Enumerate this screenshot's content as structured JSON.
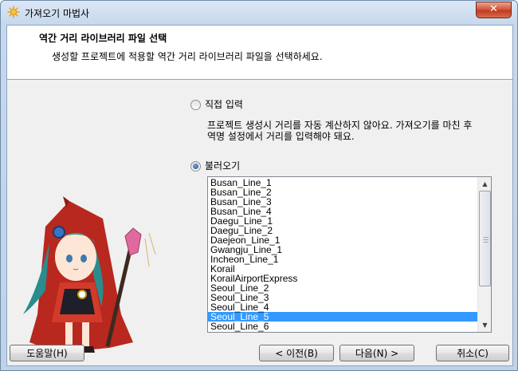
{
  "window": {
    "title": "가져오기 마법사",
    "close_label": "✕",
    "icon": "sun-icon"
  },
  "header": {
    "title": "역간 거리 라이브러리 파일 선택",
    "subtitle": "생성할 프로젝트에 적용할 역간 거리 라이브러리 파일을 선택하세요."
  },
  "options": {
    "direct_input_label": "직접 입력",
    "direct_input_checked": false,
    "direct_input_desc_line1": "프로젝트 생성시 거리를 자동 계산하지 않아요. 가져오기를 마친 후",
    "direct_input_desc_line2": "역명 설정에서 거리를 입력해야 돼요.",
    "load_label": "불러오기",
    "load_checked": true
  },
  "library_list": {
    "items": [
      "Busan_Line_1",
      "Busan_Line_2",
      "Busan_Line_3",
      "Busan_Line_4",
      "Daegu_Line_1",
      "Daegu_Line_2",
      "Daejeon_Line_1",
      "Gwangju_Line_1",
      "Incheon_Line_1",
      "Korail",
      "KorailAirportExpress",
      "Seoul_Line_2",
      "Seoul_Line_3",
      "Seoul_Line_4",
      "Seoul_Line_5",
      "Seoul_Line_6"
    ],
    "selected": "Seoul_Line_5"
  },
  "buttons": {
    "help": "도움말(H)",
    "back": "< 이전(B)",
    "next": "다음(N) >",
    "cancel": "취소(C)"
  },
  "colors": {
    "selection": "#3399ff",
    "close_button": "#c8492c"
  }
}
